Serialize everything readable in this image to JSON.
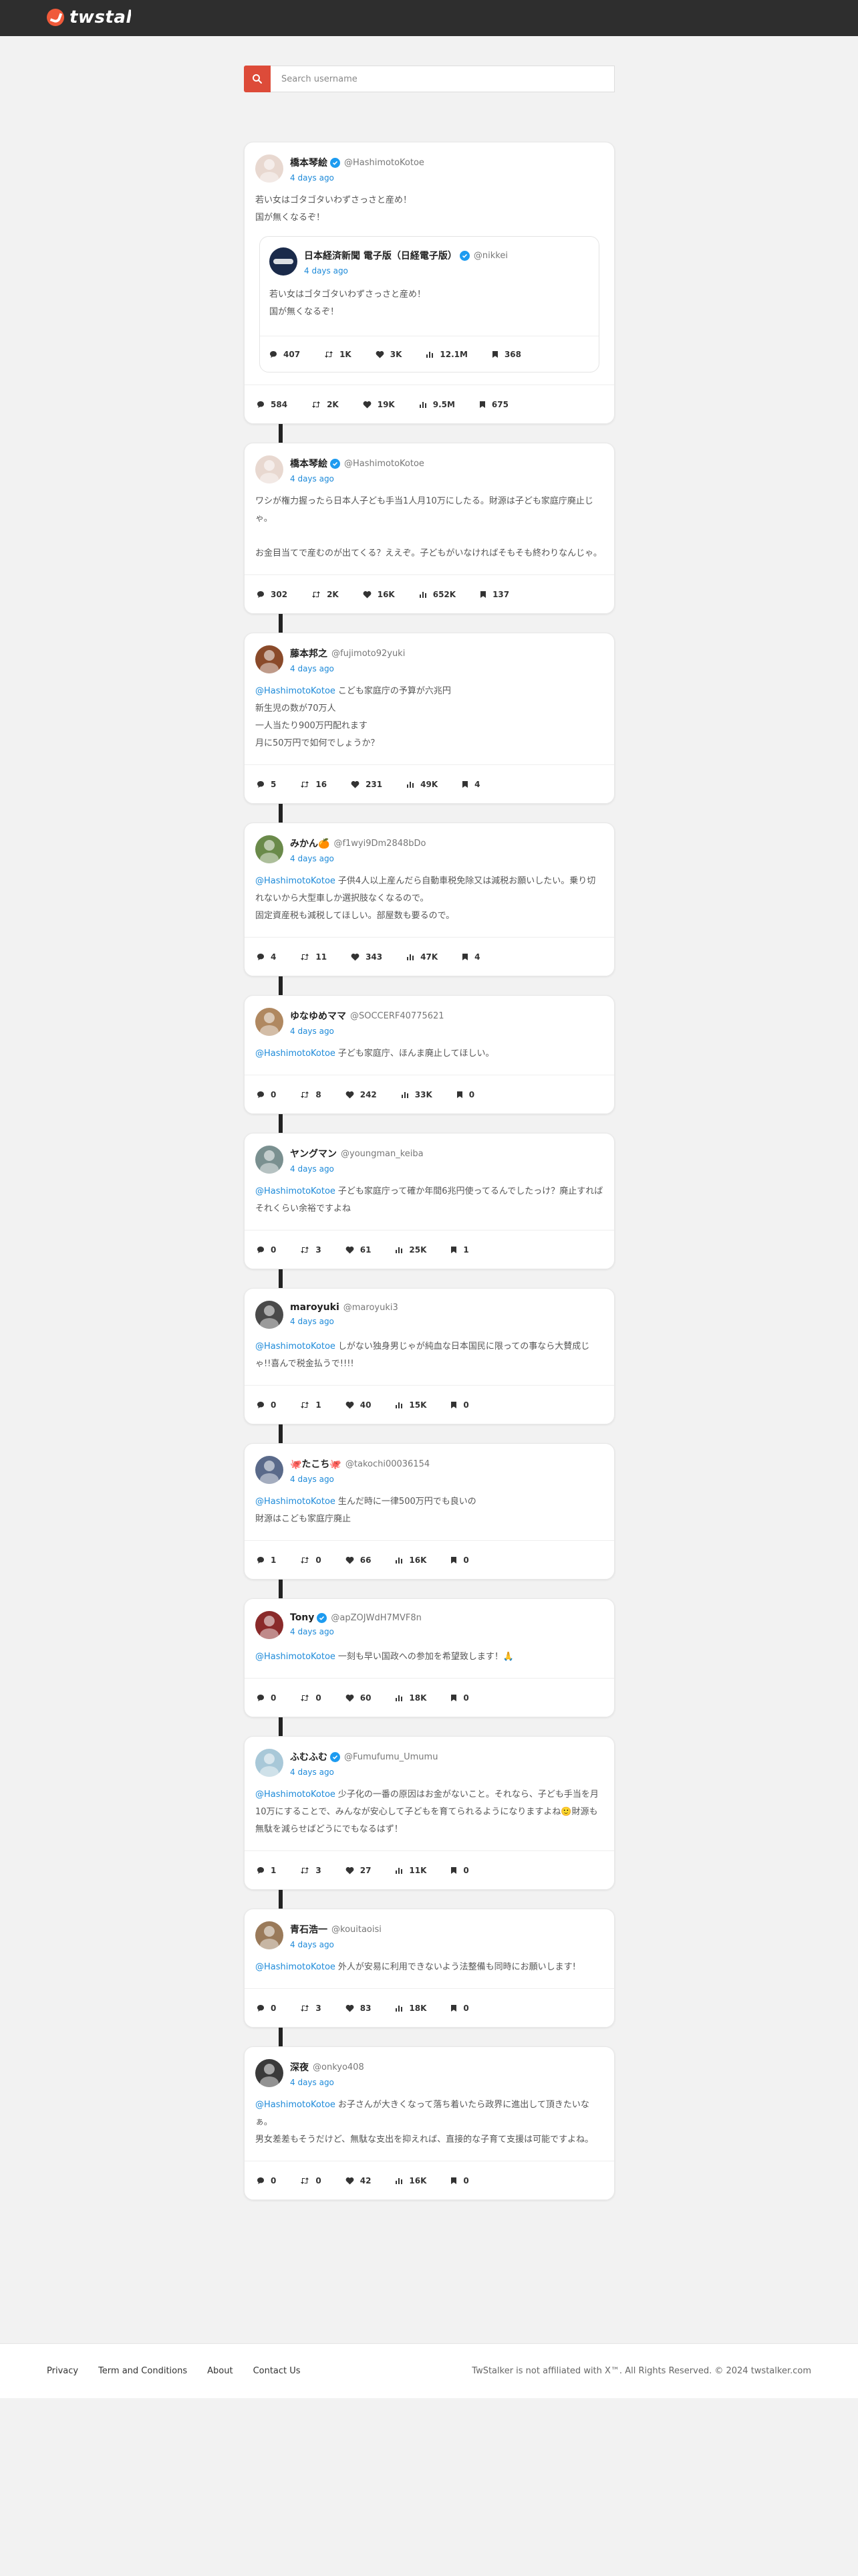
{
  "app": {
    "name": "twstalker",
    "brand_color": "#f05a3a"
  },
  "search": {
    "placeholder": "Search username",
    "value": ""
  },
  "tweets": [
    {
      "name": "橋本琴絵",
      "verified": true,
      "handle": "@HashimotoKotoe",
      "time": "4 days ago",
      "mention": "",
      "text": "若い女はゴタゴタいわずさっさと産め！\n国が無くなるぞ！",
      "quote": {
        "name": "日本経済新聞 電子版（日経電子版）",
        "verified": true,
        "handle": "@nikkei",
        "time": "4 days ago",
        "text": "若い女はゴタゴタいわずさっさと産め！\n国が無くなるぞ！",
        "stats": {
          "replies": "407",
          "retweets": "1K",
          "likes": "3K",
          "views": "12.1M",
          "bookmarks": "368"
        }
      },
      "stats": {
        "replies": "584",
        "retweets": "2K",
        "likes": "19K",
        "views": "9.5M",
        "bookmarks": "675"
      }
    },
    {
      "name": "橋本琴絵",
      "verified": true,
      "handle": "@HashimotoKotoe",
      "time": "4 days ago",
      "mention": "",
      "text": "ワシが権力握ったら日本人子ども手当1人月10万にしたる。財源は子ども家庭庁廃止じゃ。\n\nお金目当てで産むのが出てくる？ええぞ。子どもがいなければそもそも終わりなんじゃ。",
      "stats": {
        "replies": "302",
        "retweets": "2K",
        "likes": "16K",
        "views": "652K",
        "bookmarks": "137"
      }
    },
    {
      "name": "藤本邦之",
      "verified": false,
      "handle": "@fujimoto92yuki",
      "time": "4 days ago",
      "mention": "@HashimotoKotoe",
      "text": "こども家庭庁の予算が六兆円\n新生児の数が70万人\n一人当たり900万円配れます\n月に50万円で如何でしょうか？",
      "stats": {
        "replies": "5",
        "retweets": "16",
        "likes": "231",
        "views": "49K",
        "bookmarks": "4"
      }
    },
    {
      "name": "みかん🍊",
      "verified": false,
      "handle": "@f1wyi9Dm2848bDo",
      "time": "4 days ago",
      "mention": "@HashimotoKotoe",
      "text": "子供4人以上産んだら自動車税免除又は減税お願いしたい。乗り切れないから大型車しか選択肢なくなるので。\n固定資産税も減税してほしい。部屋数も要るので。",
      "stats": {
        "replies": "4",
        "retweets": "11",
        "likes": "343",
        "views": "47K",
        "bookmarks": "4"
      }
    },
    {
      "name": "ゆなゆめママ",
      "verified": false,
      "handle": "@SOCCERF40775621",
      "time": "4 days ago",
      "mention": "@HashimotoKotoe",
      "text": "子ども家庭庁、ほんま廃止してほしい。",
      "stats": {
        "replies": "0",
        "retweets": "8",
        "likes": "242",
        "views": "33K",
        "bookmarks": "0"
      }
    },
    {
      "name": "ヤングマン",
      "verified": false,
      "handle": "@youngman_keiba",
      "time": "4 days ago",
      "mention": "@HashimotoKotoe",
      "text": "子ども家庭庁って確か年間6兆円使ってるんでしたっけ？廃止すればそれくらい余裕ですよね",
      "stats": {
        "replies": "0",
        "retweets": "3",
        "likes": "61",
        "views": "25K",
        "bookmarks": "1"
      }
    },
    {
      "name": "maroyuki",
      "verified": false,
      "handle": "@maroyuki3",
      "time": "4 days ago",
      "mention": "@HashimotoKotoe",
      "text": "しがない独身男じゃが純血な日本国民に限っての事なら大賛成じゃ!!喜んで税金払うで!!!!",
      "stats": {
        "replies": "0",
        "retweets": "1",
        "likes": "40",
        "views": "15K",
        "bookmarks": "0"
      }
    },
    {
      "name": "🐙たこち🐙",
      "verified": false,
      "handle": "@takochi00036154",
      "time": "4 days ago",
      "mention": "@HashimotoKotoe",
      "text": "生んだ時に一律500万円でも良いの\n財源はこども家庭庁廃止",
      "stats": {
        "replies": "1",
        "retweets": "0",
        "likes": "66",
        "views": "16K",
        "bookmarks": "0"
      }
    },
    {
      "name": "Tony",
      "verified": true,
      "handle": "@apZOJWdH7MVF8n",
      "time": "4 days ago",
      "mention": "@HashimotoKotoe",
      "text": "一刻も早い国政への参加を希望致します！🙏",
      "stats": {
        "replies": "0",
        "retweets": "0",
        "likes": "60",
        "views": "18K",
        "bookmarks": "0"
      }
    },
    {
      "name": "ふむふむ",
      "verified": true,
      "handle": "@Fumufumu_Umumu",
      "time": "4 days ago",
      "mention": "@HashimotoKotoe",
      "text": "少子化の一番の原因はお金がないこと。それなら、子ども手当を月10万にすることで、みんなが安心して子どもを育てられるようになりますよね🙂財源も無駄を減らせばどうにでもなるはず！",
      "stats": {
        "replies": "1",
        "retweets": "3",
        "likes": "27",
        "views": "11K",
        "bookmarks": "0"
      }
    },
    {
      "name": "青石浩一",
      "verified": false,
      "handle": "@kouitaoisi",
      "time": "4 days ago",
      "mention": "@HashimotoKotoe",
      "text": "外人が安易に利用できないよう法整備も同時にお願いします!",
      "stats": {
        "replies": "0",
        "retweets": "3",
        "likes": "83",
        "views": "18K",
        "bookmarks": "0"
      }
    },
    {
      "name": "深夜",
      "verified": false,
      "handle": "@onkyo408",
      "time": "4 days ago",
      "mention": "@HashimotoKotoe",
      "text": "お子さんが大きくなって落ち着いたら政界に進出して頂きたいなぁ。\n男女差差もそうだけど、無駄な支出を抑えれば、直接的な子育て支援は可能ですよね。",
      "stats": {
        "replies": "0",
        "retweets": "0",
        "likes": "42",
        "views": "16K",
        "bookmarks": "0"
      }
    }
  ],
  "footer": {
    "links": [
      "Privacy",
      "Term and Conditions",
      "About",
      "Contact Us"
    ],
    "copyright": "TwStalker is not affiliated with X™. All Rights Reserved. © 2024 twstalker.com"
  }
}
